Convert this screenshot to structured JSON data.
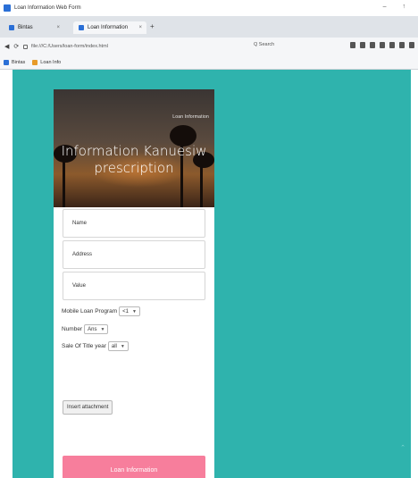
{
  "window": {
    "title": "Loan Information Web Form",
    "controls": "– ↑"
  },
  "tabs": [
    {
      "label": "Bintas",
      "active": false
    },
    {
      "label": "Loan Information",
      "active": true
    }
  ],
  "tab_close": "×",
  "new_tab": "+",
  "nav": {
    "back": "◀",
    "reload": "⟳",
    "url": "file:///C:/Users/loan-form/index.html",
    "find": "Q  Search"
  },
  "bookmarks": [
    {
      "label": "Bintas"
    },
    {
      "label": "Loan Info"
    }
  ],
  "form": {
    "badge": "Loan Information",
    "headline": "Information Kanuesiw\nprescription",
    "fields": [
      {
        "placeholder": "Name"
      },
      {
        "placeholder": "Address"
      },
      {
        "placeholder": "Value"
      }
    ],
    "rows": [
      {
        "label": "Mobile Loan Program",
        "select": "<1"
      },
      {
        "label": "Number",
        "select": "Ans"
      },
      {
        "label": "Sale Of Title year",
        "select": "all"
      }
    ],
    "file_button": "Insert attachment",
    "submit": "Loan Information"
  },
  "colors": {
    "page_bg": "#2fb3ad",
    "submit_bg": "#f77e9c"
  }
}
